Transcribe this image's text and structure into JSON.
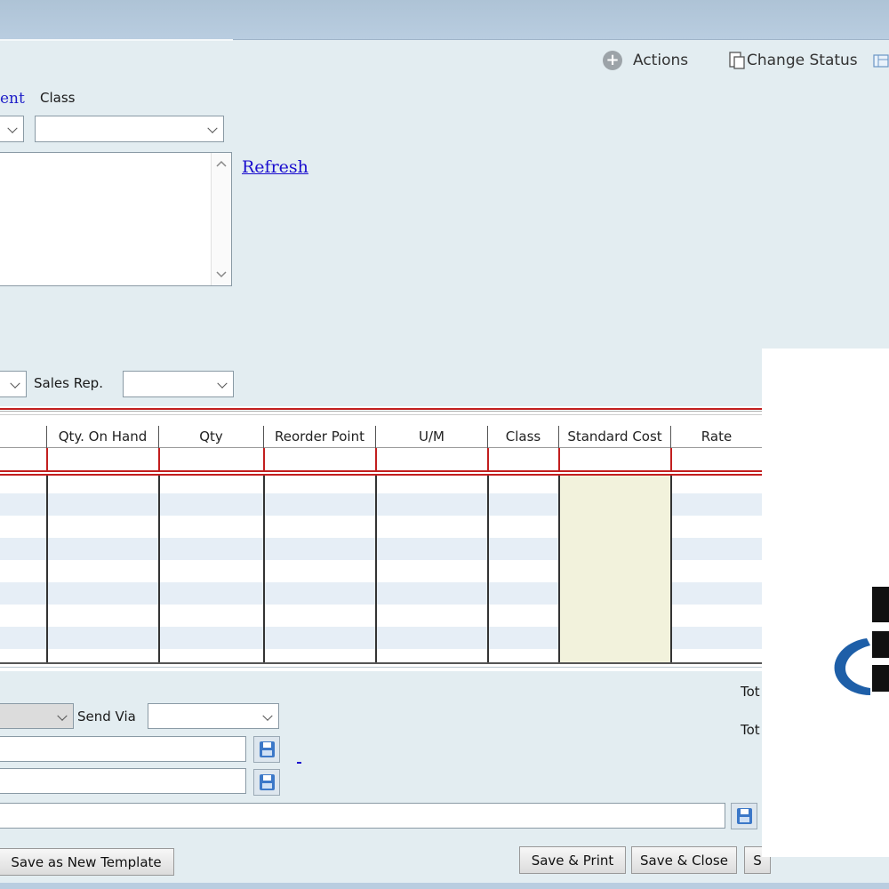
{
  "toolbar": {
    "actions_label": "Actions",
    "change_status_label": "Change Status"
  },
  "header_fields": {
    "ent_label": "ent",
    "class_label": "Class",
    "class_value": "",
    "refresh_link": "Refresh",
    "sales_rep_label": "Sales Rep.",
    "sales_rep_value": ""
  },
  "grid": {
    "columns": [
      "Qty. On Hand",
      "Qty",
      "Reorder Point",
      "U/M",
      "Class",
      "Standard Cost",
      "Rate"
    ],
    "rows": []
  },
  "footer": {
    "send_via_label": "Send Via",
    "send_via_value": "",
    "total_label_1": "Tot",
    "total_label_2": "Tot",
    "save_as_template_button": "Save as New Template",
    "save_print_button": "Save & Print",
    "save_close_button": "Save & Close",
    "third_button_partial": "S"
  },
  "colors": {
    "background": "#e3edf1",
    "grid_accent_red": "#c21f1f",
    "standard_cost_column": "#f2f2dc",
    "link": "#1a0dce"
  }
}
